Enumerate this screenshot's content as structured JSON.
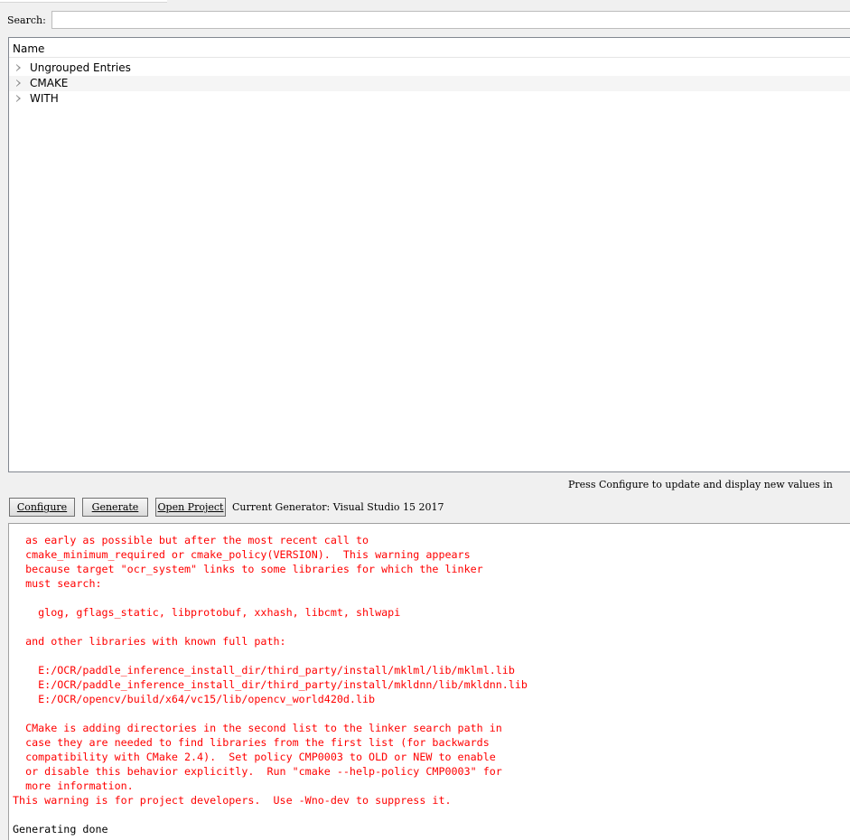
{
  "search": {
    "label": "Search:",
    "value": "",
    "placeholder": ""
  },
  "tree": {
    "header": "Name",
    "items": [
      {
        "label": "Ungrouped Entries",
        "icon": "expand-arrow-icon"
      },
      {
        "label": "CMAKE",
        "icon": "expand-arrow-icon"
      },
      {
        "label": "WITH",
        "icon": "expand-arrow-icon"
      }
    ]
  },
  "status": {
    "message": "Press Configure to update and display new values in"
  },
  "toolbar": {
    "configure_label": "Configure",
    "generate_label": "Generate",
    "open_project_label": "Open Project",
    "generator_label": "Current Generator: Visual Studio 15 2017"
  },
  "output": {
    "warning_text": "  as early as possible but after the most recent call to\n  cmake_minimum_required or cmake_policy(VERSION).  This warning appears\n  because target \"ocr_system\" links to some libraries for which the linker\n  must search:\n\n    glog, gflags_static, libprotobuf, xxhash, libcmt, shlwapi\n\n  and other libraries with known full path:\n\n    E:/OCR/paddle_inference_install_dir/third_party/install/mklml/lib/mklml.lib\n    E:/OCR/paddle_inference_install_dir/third_party/install/mkldnn/lib/mkldnn.lib\n    E:/OCR/opencv/build/x64/vc15/lib/opencv_world420d.lib\n\n  CMake is adding directories in the second list to the linker search path in\n  case they are needed to find libraries from the first list (for backwards\n  compatibility with CMake 2.4).  Set policy CMP0003 to OLD or NEW to enable\n  or disable this behavior explicitly.  Run \"cmake --help-policy CMP0003\" for\n  more information.\nThis warning is for project developers.  Use -Wno-dev to suppress it.",
    "done_text": "Generating done",
    "warning_color": "#ff0000"
  }
}
